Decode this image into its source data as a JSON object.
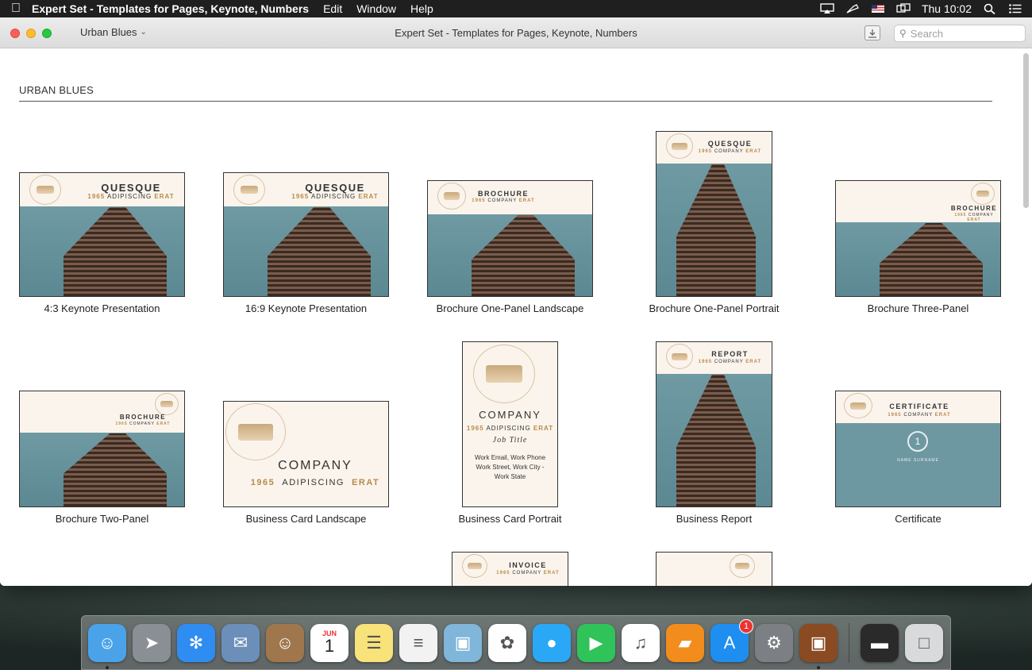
{
  "menubar": {
    "app_name": "Expert Set - Templates for Pages, Keynote, Numbers",
    "menus": [
      "Edit",
      "Window",
      "Help"
    ],
    "clock": "Thu 10:02"
  },
  "window": {
    "title": "Expert Set - Templates for Pages, Keynote, Numbers",
    "category": "Urban Blues",
    "search_placeholder": "Search"
  },
  "section": {
    "title": "URBAN BLUES"
  },
  "templates": [
    {
      "label": "4:3 Keynote Presentation",
      "heading": "QUESQUE",
      "sub": "ADIPISCING",
      "year": "1965",
      "tag": "ERAT"
    },
    {
      "label": "16:9 Keynote Presentation",
      "heading": "QUESQUE",
      "sub": "ADIPISCING",
      "year": "1965",
      "tag": "ERAT"
    },
    {
      "label": "Brochure One-Panel Landscape",
      "heading": "BROCHURE",
      "sub": "COMPANY",
      "year": "1965",
      "tag": "ERAT"
    },
    {
      "label": "Brochure One-Panel Portrait",
      "heading": "QUESQUE",
      "sub": "COMPANY",
      "year": "1965",
      "tag": "ERAT"
    },
    {
      "label": "Brochure Three-Panel",
      "heading": "BROCHURE",
      "sub": "COMPANY",
      "year": "1965",
      "tag": "ERAT"
    },
    {
      "label": "Brochure Two-Panel",
      "heading": "BROCHURE",
      "sub": "COMPANY",
      "year": "1965",
      "tag": "ERAT"
    },
    {
      "label": "Business Card Landscape",
      "heading": "COMPANY",
      "sub": "ADIPISCING",
      "year": "1965",
      "tag": "ERAT"
    },
    {
      "label": "Business Card Portrait",
      "heading": "COMPANY",
      "sub": "ADIPISCING",
      "year": "1965",
      "tag": "ERAT",
      "job": "Job Title",
      "contact1": "Work Email, Work Phone",
      "contact2": "Work Street, Work City -",
      "contact3": "Work State"
    },
    {
      "label": "Business Report",
      "heading": "REPORT",
      "sub": "COMPANY",
      "year": "1965",
      "tag": "ERAT"
    },
    {
      "label": "Certificate",
      "heading": "CERTIFICATE",
      "sub": "COMPANY",
      "year": "1965",
      "tag": "ERAT",
      "name": "NAME SURNAME",
      "seal": "1"
    },
    {
      "label": "",
      "heading": "INVOICE",
      "sub": "COMPANY",
      "year": "1965",
      "tag": "ERAT"
    },
    {
      "label": "",
      "heading": "",
      "sub": "",
      "year": "",
      "tag": ""
    }
  ],
  "dock": {
    "apps": [
      {
        "name": "Finder",
        "icon": "finder-icon",
        "color": "#4aa3e8",
        "running": true
      },
      {
        "name": "Launchpad",
        "icon": "launchpad-icon",
        "color": "#8a8f96",
        "running": false
      },
      {
        "name": "Safari",
        "icon": "safari-icon",
        "color": "#2f8cf0",
        "running": false
      },
      {
        "name": "Mail",
        "icon": "mail-icon",
        "color": "#6b8fb8",
        "running": false
      },
      {
        "name": "Contacts",
        "icon": "contacts-icon",
        "color": "#a0774d",
        "running": false
      },
      {
        "name": "Calendar",
        "icon": "calendar-icon",
        "color": "#ffffff",
        "running": false,
        "month": "JUN",
        "day": "1"
      },
      {
        "name": "Notes",
        "icon": "notes-icon",
        "color": "#f8e27a",
        "running": false
      },
      {
        "name": "Reminders",
        "icon": "reminders-icon",
        "color": "#f2f2f2",
        "running": false
      },
      {
        "name": "Preview",
        "icon": "preview-icon",
        "color": "#7fb6d9",
        "running": false
      },
      {
        "name": "Photos",
        "icon": "photos-icon",
        "color": "#ffffff",
        "running": false
      },
      {
        "name": "Messages",
        "icon": "messages-icon",
        "color": "#2aa8f5",
        "running": false
      },
      {
        "name": "FaceTime",
        "icon": "facetime-icon",
        "color": "#2fc35a",
        "running": false
      },
      {
        "name": "iTunes",
        "icon": "itunes-icon",
        "color": "#ffffff",
        "running": false
      },
      {
        "name": "iBooks",
        "icon": "ibooks-icon",
        "color": "#f28c1c",
        "running": false
      },
      {
        "name": "App Store",
        "icon": "appstore-icon",
        "color": "#1e8ff0",
        "running": false,
        "badge": "1"
      },
      {
        "name": "System Preferences",
        "icon": "system-preferences-icon",
        "color": "#7c8084",
        "running": false
      },
      {
        "name": "Expert Set",
        "icon": "briefcase-icon",
        "color": "#8a4a22",
        "running": true
      }
    ],
    "extras": [
      {
        "name": "Desktop Stack",
        "icon": "stack-icon",
        "color": "#2a2a2a"
      },
      {
        "name": "Trash",
        "icon": "trash-icon",
        "color": "#d8dadc"
      }
    ]
  }
}
